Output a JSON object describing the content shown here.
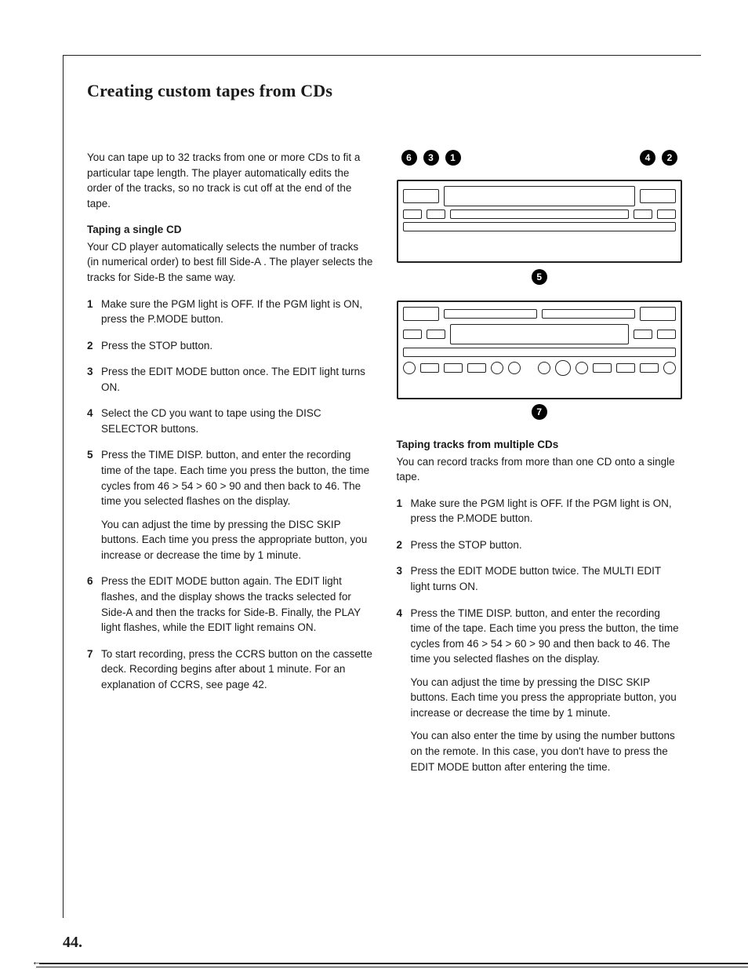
{
  "page_number": "44.",
  "title": "Creating custom tapes from CDs",
  "intro": "You can tape up to 32 tracks from one or more CDs to fit a particular tape length. The player automatically edits the order of the tracks, so no track is cut off at the end of the tape.",
  "section_a": {
    "heading": "Taping a single CD",
    "lede": "Your CD player automatically selects the number of tracks (in numerical order) to best fill Side-A . The player selects the tracks for Side-B the same way.",
    "steps": [
      {
        "n": "1",
        "text": "Make sure the PGM light is OFF. If the PGM light is ON, press the P.MODE button."
      },
      {
        "n": "2",
        "text": "Press the STOP button."
      },
      {
        "n": "3",
        "text": "Press the EDIT MODE button once. The EDIT light turns ON."
      },
      {
        "n": "4",
        "text": "Select the CD you want to tape using the DISC SELECTOR buttons."
      },
      {
        "n": "5",
        "text": "Press the TIME DISP. button, and enter the recording time of the tape. Each time you press the button, the time cycles from 46 > 54 > 60 > 90 and then back to 46. The time you selected flashes on the display.",
        "sub": "You can adjust the time by pressing the DISC SKIP buttons. Each time you press the appropriate button, you increase or decrease the time by 1 minute."
      },
      {
        "n": "6",
        "text": "Press the EDIT MODE button again. The EDIT light flashes, and the display shows the tracks selected for Side-A and then the tracks for Side-B. Finally, the PLAY light flashes, while the EDIT light remains ON."
      },
      {
        "n": "7",
        "text": "To start recording, press the CCRS button on the cassette deck. Recording begins after about 1 minute. For an explanation of CCRS, see page 42."
      }
    ]
  },
  "callouts_upper": [
    "6",
    "3",
    "1",
    "4",
    "2"
  ],
  "callout_5": "5",
  "callout_7": "7",
  "section_b": {
    "heading": "Taping tracks from multiple CDs",
    "lede": "You can record tracks from more than one CD onto a single tape.",
    "steps": [
      {
        "n": "1",
        "text": "Make sure the PGM light is OFF. If the PGM light is ON, press the P.MODE button."
      },
      {
        "n": "2",
        "text": "Press the STOP button."
      },
      {
        "n": "3",
        "text": "Press the EDIT MODE button twice. The MULTI EDIT light turns ON."
      },
      {
        "n": "4",
        "text": "Press the TIME DISP. button, and enter the recording time of the tape. Each time you press the button, the time cycles from 46 > 54 > 60 > 90 and then back to 46. The time you selected flashes on the display.",
        "sub": "You can adjust the time by pressing the DISC SKIP buttons. Each time you press the appropriate button, you increase or decrease the time by 1 minute.",
        "sub2": "You can also enter the time by using the number buttons on the remote. In this case, you don't have to press the EDIT MODE button after entering the time."
      }
    ]
  }
}
